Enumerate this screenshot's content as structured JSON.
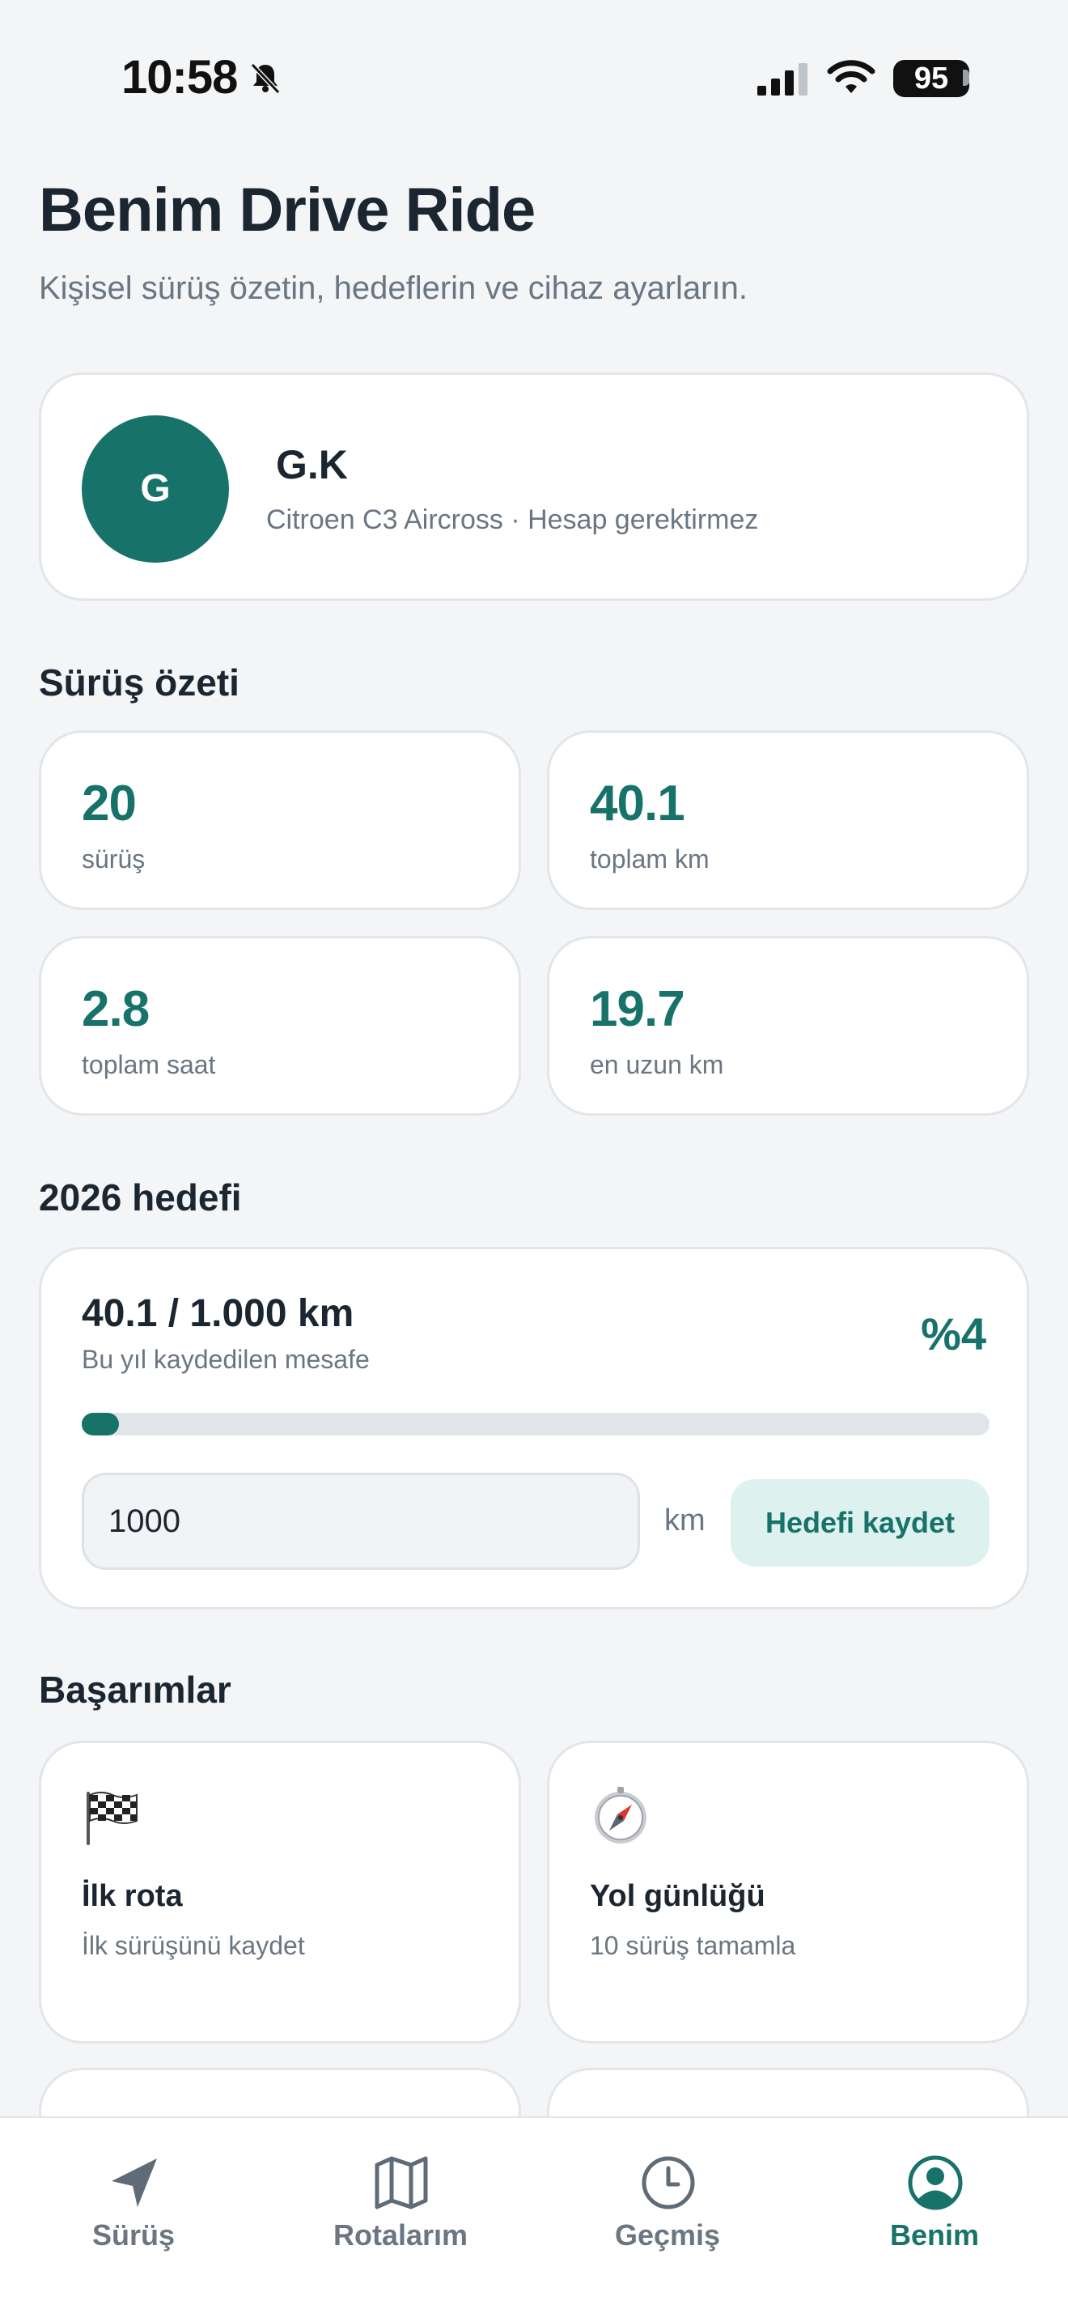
{
  "status_bar": {
    "time": "10:58",
    "battery": "95"
  },
  "header": {
    "title": "Benim Drive Ride",
    "subtitle": "Kişisel sürüş özetin, hedeflerin ve cihaz ayarların."
  },
  "profile": {
    "initial": "G",
    "name": "G.K",
    "details": "Citroen C3 Aircross · Hesap gerektirmez"
  },
  "summary": {
    "title": "Sürüş özeti",
    "stats": [
      {
        "value": "20",
        "label": "sürüş"
      },
      {
        "value": "40.1",
        "label": "toplam km"
      },
      {
        "value": "2.8",
        "label": "toplam saat"
      },
      {
        "value": "19.7",
        "label": "en uzun km"
      }
    ]
  },
  "goal": {
    "title": "2026 hedefi",
    "main": "40.1 / 1.000 km",
    "sub": "Bu yıl kaydedilen mesafe",
    "percent_label": "%4",
    "progress_fraction": 0.04,
    "input_value": "1000",
    "unit": "km",
    "save_label": "Hedefi kaydet"
  },
  "achievements": {
    "title": "Başarımlar",
    "items": [
      {
        "icon": "checkered-flag-icon",
        "title": "İlk rota",
        "desc": "İlk sürüşünü kaydet"
      },
      {
        "icon": "compass-icon",
        "title": "Yol günlüğü",
        "desc": "10 sürüş tamamla"
      }
    ]
  },
  "tabs": [
    {
      "label": "Sürüş",
      "icon": "navigation-arrow-icon",
      "active": false
    },
    {
      "label": "Rotalarım",
      "icon": "map-icon",
      "active": false
    },
    {
      "label": "Geçmiş",
      "icon": "clock-icon",
      "active": false
    },
    {
      "label": "Benim",
      "icon": "profile-icon",
      "active": true
    }
  ],
  "colors": {
    "accent": "#17726a",
    "accent_light": "#ddf1ef",
    "background": "#f3f5f7",
    "muted_text": "#6a7682"
  }
}
